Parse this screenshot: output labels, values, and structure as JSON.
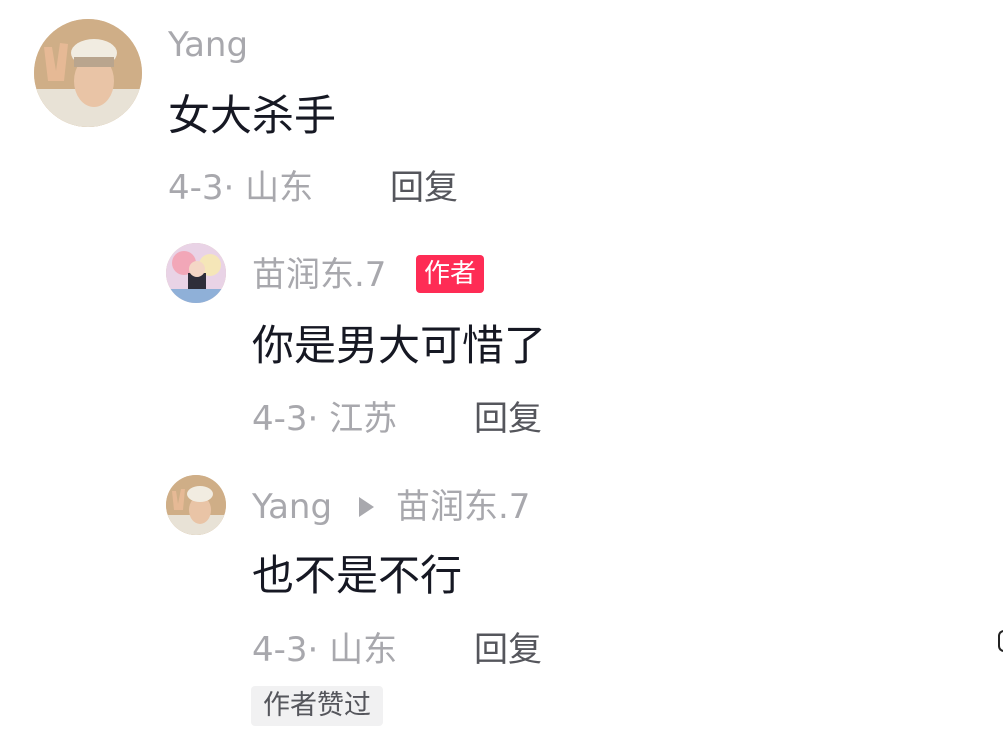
{
  "comments": [
    {
      "username": "Yang",
      "text": "女大杀手",
      "meta": "4-3· 山东",
      "reply": "回复",
      "avatar_icon": "person-peace-sign-avatar"
    }
  ],
  "replies": [
    {
      "username": "苗润东.7",
      "badge": "作者",
      "badge_color": "#fe2c55",
      "text": "你是男大可惜了",
      "meta": "4-3· 江苏",
      "reply": "回复",
      "avatar_icon": "anime-character-avatar"
    },
    {
      "username": "Yang",
      "reply_to": "苗润东.7",
      "text": "也不是不行",
      "meta": "4-3· 山东",
      "reply": "回复",
      "liked_tag": "作者赞过",
      "avatar_icon": "person-peace-sign-avatar"
    }
  ]
}
